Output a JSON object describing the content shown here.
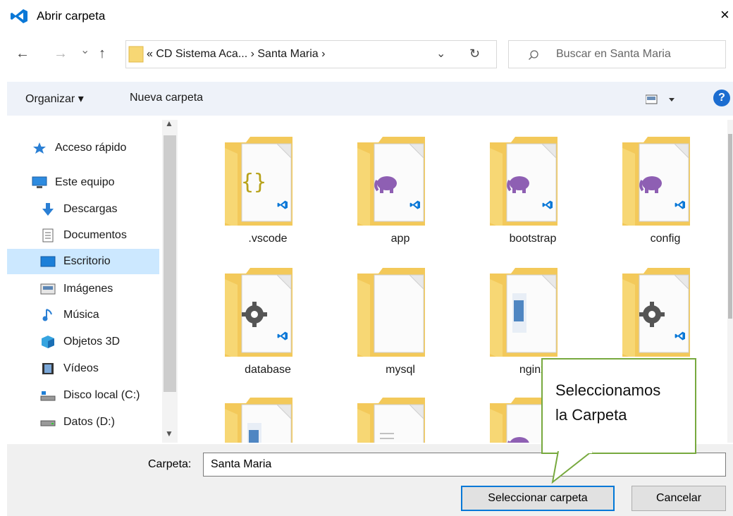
{
  "window": {
    "title": "Abrir carpeta",
    "close_glyph": "×"
  },
  "nav": {
    "back_glyph": "←",
    "forward_glyph": "→",
    "recent_glyph": "⌄",
    "up_glyph": "↑",
    "address": "« CD Sistema Aca...  ›  Santa Maria  ›",
    "dropdown_glyph": "⌄",
    "refresh_glyph": "↻",
    "search_placeholder": "Buscar en Santa Maria"
  },
  "toolbar": {
    "organize_label": "Organizar ▾",
    "new_folder_label": "Nueva carpeta",
    "help_glyph": "?"
  },
  "sidebar": {
    "items": [
      {
        "label": "Acceso rápido",
        "icon": "star-icon"
      },
      {
        "label": "Este equipo",
        "icon": "computer-icon"
      },
      {
        "label": "Descargas",
        "icon": "download-icon"
      },
      {
        "label": "Documentos",
        "icon": "document-icon"
      },
      {
        "label": "Escritorio",
        "icon": "desktop-icon"
      },
      {
        "label": "Imágenes",
        "icon": "image-icon"
      },
      {
        "label": "Música",
        "icon": "music-icon"
      },
      {
        "label": "Objetos 3D",
        "icon": "cube-icon"
      },
      {
        "label": "Vídeos",
        "icon": "video-icon"
      },
      {
        "label": "Disco local (C:)",
        "icon": "disk-icon"
      },
      {
        "label": "Datos (D:)",
        "icon": "drive-icon"
      }
    ],
    "selected": "Escritorio"
  },
  "folders": [
    {
      "name": ".vscode",
      "overlay": "json-icon"
    },
    {
      "name": "app",
      "overlay": "php-icon"
    },
    {
      "name": "bootstrap",
      "overlay": "php-icon"
    },
    {
      "name": "config",
      "overlay": "php-icon"
    },
    {
      "name": "database",
      "overlay": "gear-icon"
    },
    {
      "name": "mysql",
      "overlay": "blank-icon"
    },
    {
      "name": "nginx",
      "overlay": "image-icon"
    },
    {
      "name": "",
      "overlay": "gear-icon"
    },
    {
      "name": "",
      "overlay": "image-icon"
    },
    {
      "name": "",
      "overlay": "document-icon"
    },
    {
      "name": "",
      "overlay": "php-icon"
    },
    {
      "name": "",
      "overlay": "blank-icon"
    }
  ],
  "footer": {
    "folder_label": "Carpeta:",
    "folder_value": "Santa Maria",
    "select_button": "Seleccionar carpeta",
    "cancel_button": "Cancelar"
  },
  "callout": {
    "line1": "Seleccionamos",
    "line2": "la Carpeta"
  },
  "colors": {
    "accent": "#0078d7",
    "selection": "#cce8ff",
    "folder": "#f7d774",
    "callout_border": "#77a93e",
    "vscode_blue": "#0a78d7",
    "php_purple": "#8e5fb3"
  }
}
